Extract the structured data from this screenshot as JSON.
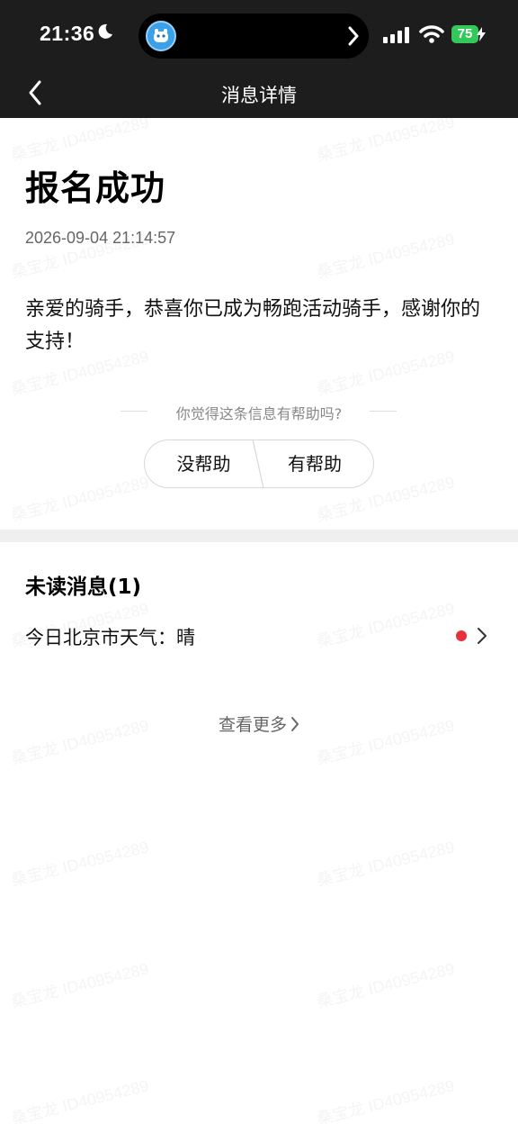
{
  "status_bar": {
    "time": "21:36",
    "battery": "75",
    "icons": [
      "moon-icon",
      "app-icon",
      "chevron-right-icon",
      "signal-icon",
      "wifi-icon",
      "charging-icon"
    ]
  },
  "nav": {
    "title": "消息详情",
    "back_icon": "chevron-left-icon"
  },
  "message": {
    "title": "报名成功",
    "time": "2026-09-04 21:14:57",
    "body": "亲爱的骑手，恭喜你已成为畅跑活动骑手，感谢你的支持！"
  },
  "feedback": {
    "question": "你觉得这条信息有帮助吗?",
    "no_label": "没帮助",
    "yes_label": "有帮助"
  },
  "unread": {
    "title": "未读消息(1)",
    "items": [
      {
        "text": "今日北京市天气：晴"
      }
    ]
  },
  "more": {
    "label": "查看更多"
  },
  "watermark": {
    "text": "桑宝龙 ID40954289"
  },
  "colors": {
    "header_bg": "#1d1d1d",
    "battery": "#34c759",
    "unread_dot": "#e8303a"
  }
}
